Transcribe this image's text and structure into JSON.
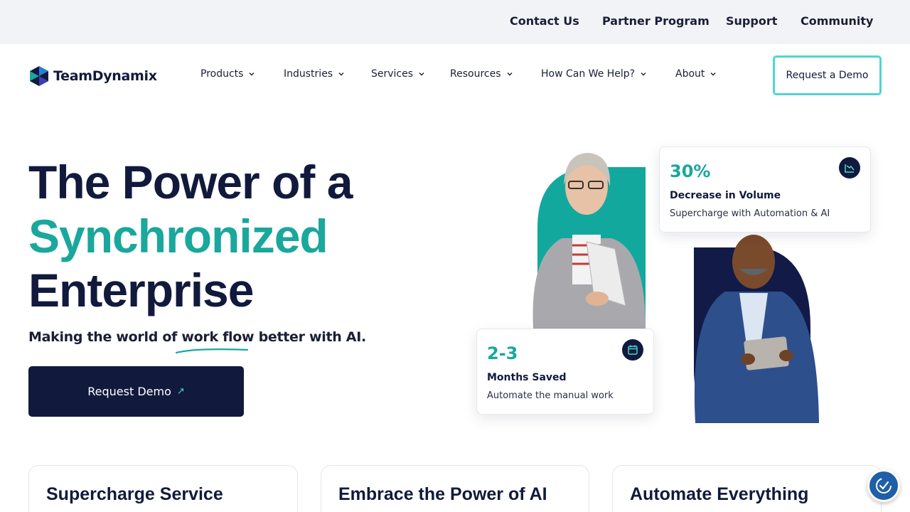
{
  "top_links": [
    "Contact Us",
    "Partner Program",
    "Support",
    "Community"
  ],
  "brand": {
    "name": "TeamDynamix"
  },
  "nav": {
    "items": [
      "Products",
      "Industries",
      "Services",
      "Resources",
      "How Can We Help?",
      "About"
    ],
    "demo_button": "Request a Demo"
  },
  "hero": {
    "line1": "The Power of a",
    "line2": "Synchronized",
    "line3": "Enterprise",
    "subtitle": "Making the world of work flow better with AI.",
    "cta": "Request Demo"
  },
  "stats": [
    {
      "value": "30%",
      "label": "Decrease in Volume",
      "desc": "Supercharge with Automation & AI",
      "icon": "chart-down-icon"
    },
    {
      "value": "2-3",
      "label": "Months Saved",
      "desc": "Automate the manual work",
      "icon": "calendar-icon"
    }
  ],
  "features": [
    "Supercharge Service",
    "Embrace the Power of AI",
    "Automate Everything"
  ],
  "colors": {
    "navy": "#111a3d",
    "teal": "#1aa79c",
    "cyan_border": "#4fd6d1",
    "topbar_bg": "#f2f3f7"
  }
}
